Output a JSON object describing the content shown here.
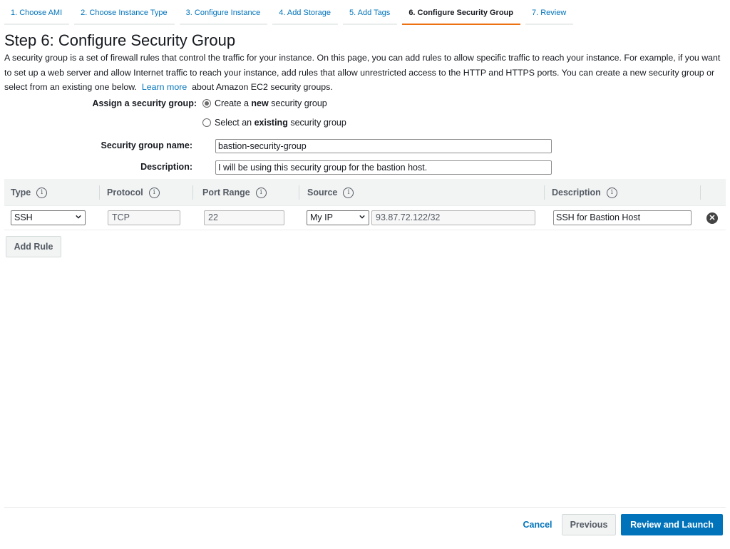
{
  "steps": [
    {
      "label": "1. Choose AMI"
    },
    {
      "label": "2. Choose Instance Type"
    },
    {
      "label": "3. Configure Instance"
    },
    {
      "label": "4. Add Storage"
    },
    {
      "label": "5. Add Tags"
    },
    {
      "label": "6. Configure Security Group"
    },
    {
      "label": "7. Review"
    }
  ],
  "active_step": 6,
  "page": {
    "title": "Step 6: Configure Security Group",
    "intro": "A security group is a set of firewall rules that control the traffic for your instance. On this page, you can add rules to allow specific traffic to reach your instance. For example, if you want to set up a web server and allow Internet traffic to reach your instance, add rules that allow unrestricted access to the HTTP and HTTPS ports. You can create a new security group or select from an existing one below.",
    "learn_more": "Learn more",
    "intro_tail": "about Amazon EC2 security groups."
  },
  "assign": {
    "label": "Assign a security group:",
    "option_new_pre": "Create a ",
    "option_new_bold": "new",
    "option_new_post": " security group",
    "option_existing_pre": "Select an ",
    "option_existing_bold": "existing",
    "option_existing_post": " security group",
    "selected": "new"
  },
  "group_name": {
    "label": "Security group name:",
    "value": "bastion-security-group"
  },
  "group_description": {
    "label": "Description:",
    "value": "I will be using this security group for the bastion host."
  },
  "table": {
    "headers": {
      "type": "Type",
      "protocol": "Protocol",
      "port_range": "Port Range",
      "source": "Source",
      "description": "Description"
    },
    "info_glyph": "i",
    "rows": [
      {
        "type": "SSH",
        "protocol": "TCP",
        "port_range": "22",
        "source_type": "My IP",
        "source_cidr": "93.87.72.122/32",
        "description": "SSH for Bastion Host"
      }
    ]
  },
  "add_rule_label": "Add Rule",
  "footer": {
    "cancel": "Cancel",
    "previous": "Previous",
    "review_launch": "Review and Launch"
  },
  "colors": {
    "accent": "#0073bb",
    "active_step_underline": "#ec7211"
  }
}
